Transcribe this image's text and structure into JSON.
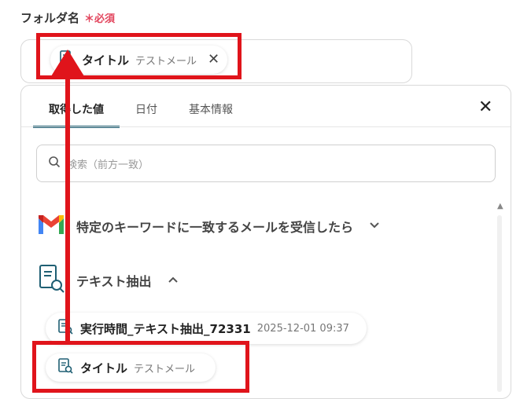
{
  "field": {
    "label": "フォルダ名",
    "required_mark": "＊",
    "required_text": "必須",
    "chip": {
      "title": "タイトル",
      "subtitle": "テストメール",
      "close_icon": "close-icon"
    }
  },
  "panel": {
    "tabs": [
      {
        "label": "取得した値",
        "active": true
      },
      {
        "label": "日付",
        "active": false
      },
      {
        "label": "基本情報",
        "active": false
      }
    ],
    "search_placeholder": "検索（前方一致）",
    "sections": [
      {
        "label": "特定のキーワードに一致するメールを受信したら",
        "icon": "gmail-icon",
        "expanded": false
      },
      {
        "label": "テキスト抽出",
        "icon": "document-search-icon",
        "expanded": true
      }
    ],
    "values": [
      {
        "title": "実行時間_テキスト抽出_72331",
        "value": "2025-12-01 09:37"
      },
      {
        "title": "タイトル",
        "value": "テストメール"
      }
    ]
  },
  "colors": {
    "accent": "#1f5f73",
    "highlight_red": "#e0141b",
    "required": "#e2445c"
  }
}
